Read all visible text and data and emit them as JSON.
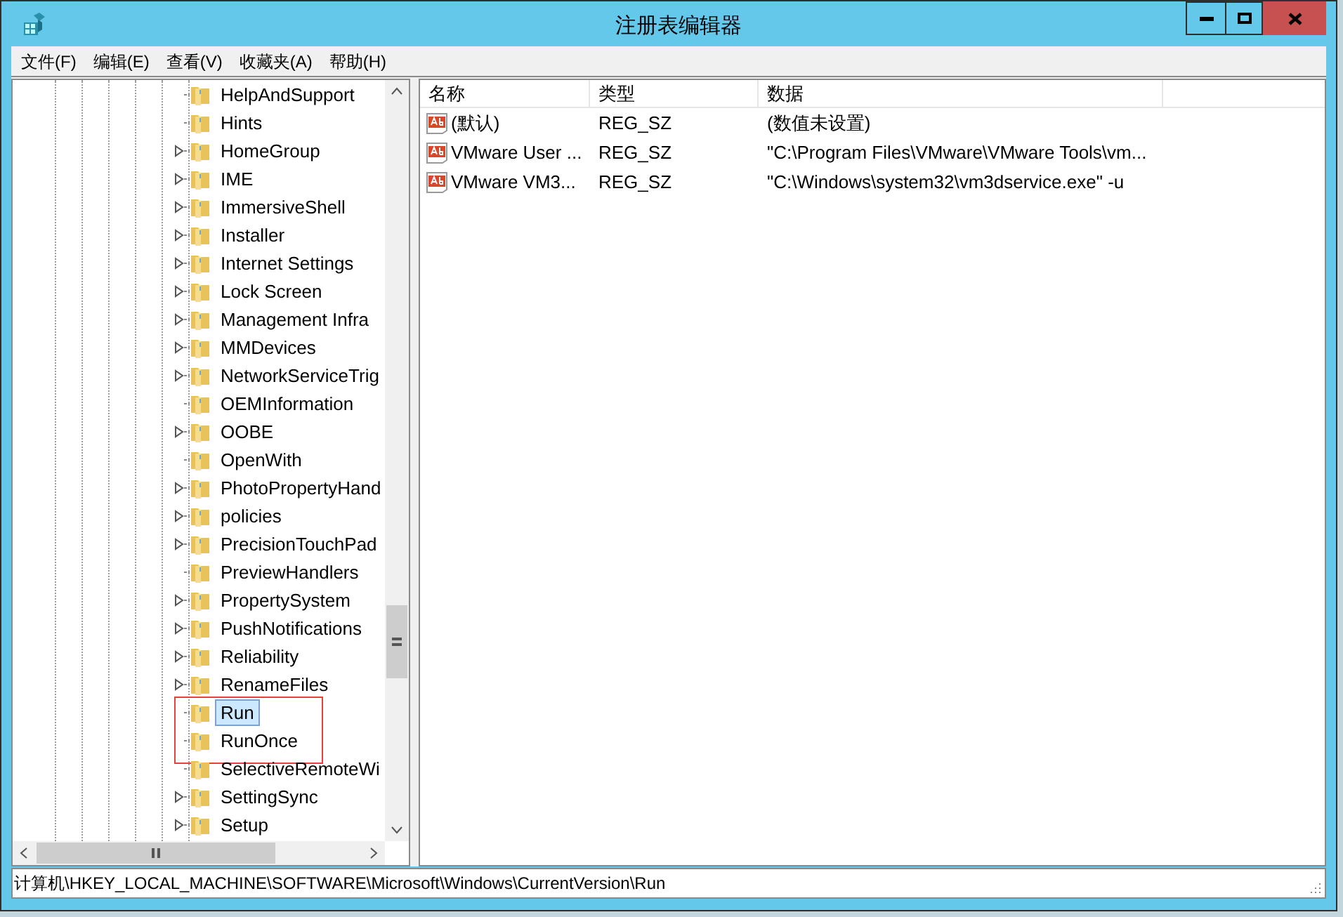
{
  "window": {
    "title": "注册表编辑器"
  },
  "menu": [
    "文件(F)",
    "编辑(E)",
    "查看(V)",
    "收藏夹(A)",
    "帮助(H)"
  ],
  "tree": {
    "items": [
      {
        "label": "HelpAndSupport",
        "expandable": false,
        "selected": false,
        "marked": false
      },
      {
        "label": "Hints",
        "expandable": false,
        "selected": false,
        "marked": false
      },
      {
        "label": "HomeGroup",
        "expandable": true,
        "selected": false,
        "marked": false
      },
      {
        "label": "IME",
        "expandable": true,
        "selected": false,
        "marked": false
      },
      {
        "label": "ImmersiveShell",
        "expandable": true,
        "selected": false,
        "marked": false
      },
      {
        "label": "Installer",
        "expandable": true,
        "selected": false,
        "marked": false
      },
      {
        "label": "Internet Settings",
        "expandable": true,
        "selected": false,
        "marked": false
      },
      {
        "label": "Lock Screen",
        "expandable": true,
        "selected": false,
        "marked": false
      },
      {
        "label": "Management Infra",
        "expandable": true,
        "selected": false,
        "marked": false
      },
      {
        "label": "MMDevices",
        "expandable": true,
        "selected": false,
        "marked": false
      },
      {
        "label": "NetworkServiceTrig",
        "expandable": true,
        "selected": false,
        "marked": false
      },
      {
        "label": "OEMInformation",
        "expandable": false,
        "selected": false,
        "marked": false
      },
      {
        "label": "OOBE",
        "expandable": true,
        "selected": false,
        "marked": false
      },
      {
        "label": "OpenWith",
        "expandable": false,
        "selected": false,
        "marked": false
      },
      {
        "label": "PhotoPropertyHand",
        "expandable": true,
        "selected": false,
        "marked": false
      },
      {
        "label": "policies",
        "expandable": true,
        "selected": false,
        "marked": false
      },
      {
        "label": "PrecisionTouchPad",
        "expandable": true,
        "selected": false,
        "marked": false
      },
      {
        "label": "PreviewHandlers",
        "expandable": false,
        "selected": false,
        "marked": false
      },
      {
        "label": "PropertySystem",
        "expandable": true,
        "selected": false,
        "marked": false
      },
      {
        "label": "PushNotifications",
        "expandable": true,
        "selected": false,
        "marked": false
      },
      {
        "label": "Reliability",
        "expandable": true,
        "selected": false,
        "marked": false
      },
      {
        "label": "RenameFiles",
        "expandable": true,
        "selected": false,
        "marked": false
      },
      {
        "label": "Run",
        "expandable": false,
        "selected": true,
        "marked": true
      },
      {
        "label": "RunOnce",
        "expandable": false,
        "selected": false,
        "marked": true
      },
      {
        "label": "SelectiveRemoteWi",
        "expandable": false,
        "selected": false,
        "marked": false
      },
      {
        "label": "SettingSync",
        "expandable": true,
        "selected": false,
        "marked": false
      },
      {
        "label": "Setup",
        "expandable": true,
        "selected": false,
        "marked": false
      }
    ]
  },
  "table": {
    "columns": [
      "名称",
      "类型",
      "数据"
    ],
    "rows": [
      {
        "name": "(默认)",
        "type": "REG_SZ",
        "data": "(数值未设置)"
      },
      {
        "name": "VMware User ...",
        "type": "REG_SZ",
        "data": "\"C:\\Program Files\\VMware\\VMware Tools\\vm..."
      },
      {
        "name": "VMware VM3...",
        "type": "REG_SZ",
        "data": "\"C:\\Windows\\system32\\vm3dservice.exe\" -u"
      }
    ]
  },
  "status_bar": "计算机\\HKEY_LOCAL_MACHINE\\SOFTWARE\\Microsoft\\Windows\\CurrentVersion\\Run"
}
